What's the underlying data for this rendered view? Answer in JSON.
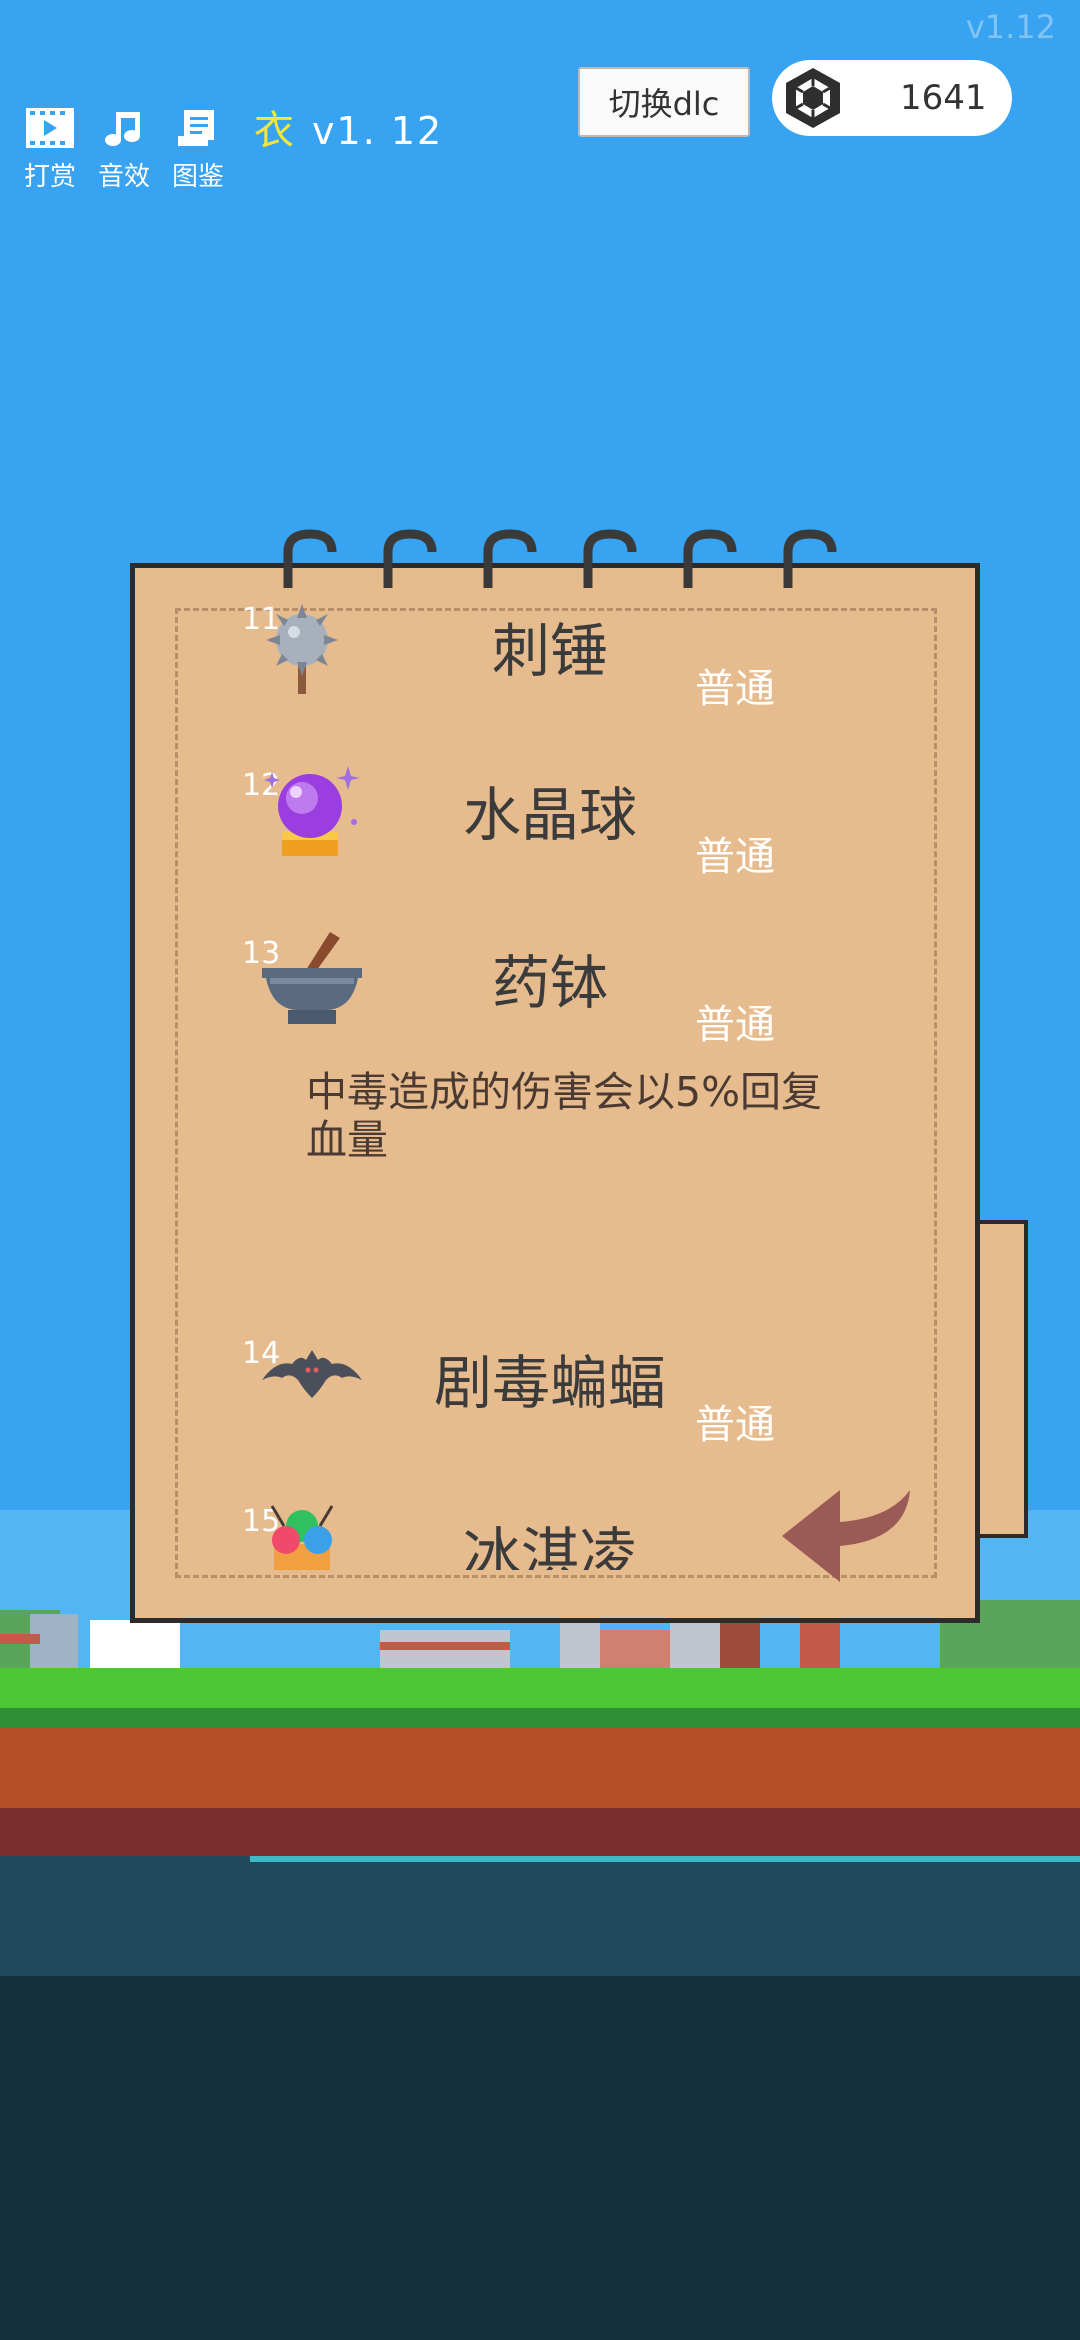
{
  "version_corner": "v1.12",
  "toolbar": {
    "items": [
      {
        "label": "打赏",
        "icon": "film-icon"
      },
      {
        "label": "音效",
        "icon": "music-note-icon"
      },
      {
        "label": "图鉴",
        "icon": "scroll-book-icon"
      }
    ],
    "yi_char": "衣",
    "version": "v1. 12"
  },
  "dlc_button": "切换dlc",
  "currency": {
    "icon": "gem-icon",
    "count": "1641"
  },
  "items": [
    {
      "num": "11",
      "name": "刺锤",
      "rarity": "普通",
      "icon": "spiked-mace-icon"
    },
    {
      "num": "12",
      "name": "水晶球",
      "rarity": "普通",
      "icon": "crystal-ball-icon"
    },
    {
      "num": "13",
      "name": "药钵",
      "rarity": "普通",
      "icon": "mortar-pestle-icon",
      "description": "中毒造成的伤害会以5%回复血量"
    },
    {
      "num": "14",
      "name": "剧毒蝙蝠",
      "rarity": "普通",
      "icon": "bat-icon"
    },
    {
      "num": "15",
      "name": "冰淇凌",
      "icon": "ice-cream-icon"
    }
  ],
  "back": {
    "icon": "back-arrow-icon"
  },
  "colors": {
    "sky": "#38a3f0",
    "paper": "#e6bc8f",
    "rarity_text": "#ffffff",
    "accent_yellow": "#f5e63a"
  }
}
